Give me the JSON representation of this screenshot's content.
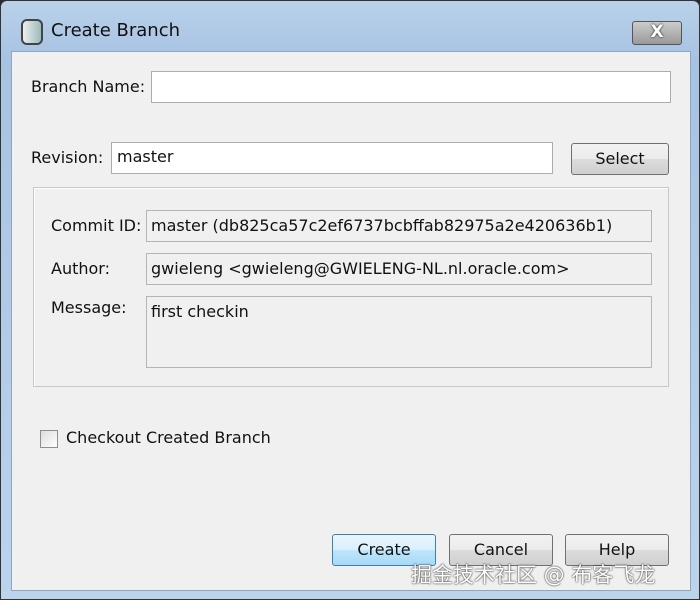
{
  "window": {
    "title": "Create Branch",
    "close_label": "X"
  },
  "form": {
    "branch_name_label": "Branch Name:",
    "branch_name_value": "",
    "revision_label": "Revision:",
    "revision_value": "master",
    "select_button": "Select"
  },
  "details": {
    "commit_id_label": "Commit ID:",
    "commit_id_value": "master (db825ca57c2ef6737bcbffab82975a2e420636b1)",
    "author_label": "Author:",
    "author_value": "gwieleng <gwieleng@GWIELENG-NL.nl.oracle.com>",
    "message_label": "Message:",
    "message_value": "first checkin"
  },
  "checkout_label": "Checkout Created Branch",
  "checkout_checked": false,
  "buttons": {
    "create": "Create",
    "cancel": "Cancel",
    "help": "Help"
  },
  "watermark": "掘金技术社区 @ 布客飞龙"
}
